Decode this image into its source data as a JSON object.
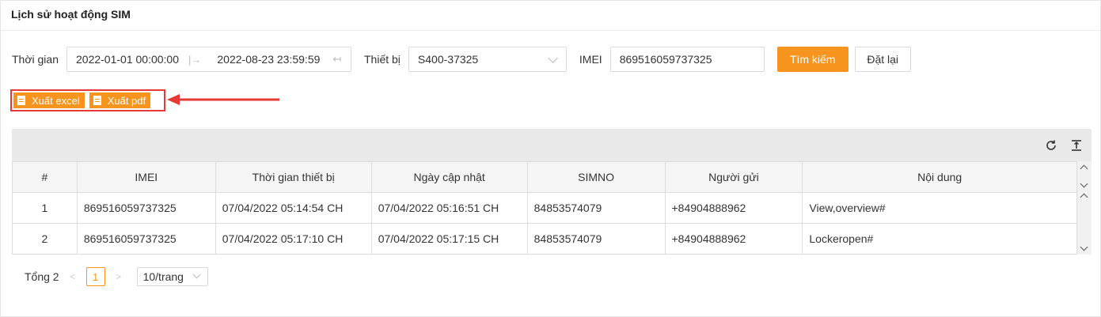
{
  "page": {
    "title": "Lịch sử hoạt động SIM"
  },
  "filters": {
    "time_label": "Thời gian",
    "start": "2022-01-01 00:00:00",
    "end": "2022-08-23 23:59:59",
    "device_label": "Thiết bị",
    "device_value": "S400-37325",
    "imei_label": "IMEI",
    "imei_value": "869516059737325",
    "search_label": "Tìm kiếm",
    "reset_label": "Đặt lại"
  },
  "export": {
    "excel_label": "Xuất excel",
    "pdf_label": "Xuất pdf"
  },
  "table": {
    "columns": [
      "#",
      "IMEI",
      "Thời gian thiết bị",
      "Ngày cập nhật",
      "SIMNO",
      "Người gửi",
      "Nội dung"
    ],
    "rows": [
      [
        "1",
        "869516059737325",
        "07/04/2022 05:14:54 CH",
        "07/04/2022 05:16:51 CH",
        "84853574079",
        "+84904888962",
        "View,overview#"
      ],
      [
        "2",
        "869516059737325",
        "07/04/2022 05:17:10 CH",
        "07/04/2022 05:17:15 CH",
        "84853574079",
        "+84904888962",
        "Lockeropen#"
      ]
    ]
  },
  "pagination": {
    "total_label": "Tổng 2",
    "current_page": "1",
    "page_size": "10/trang"
  },
  "colors": {
    "accent": "#f7941d",
    "highlight": "#e53935"
  }
}
